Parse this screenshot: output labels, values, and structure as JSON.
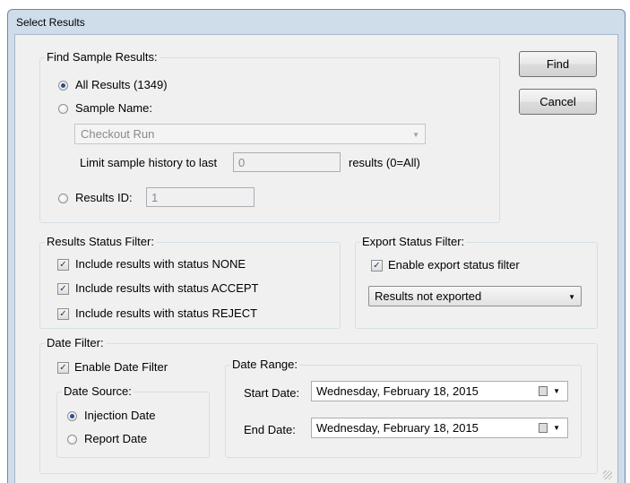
{
  "window": {
    "title": "Select Results"
  },
  "buttons": {
    "find": "Find",
    "cancel": "Cancel"
  },
  "find_sample": {
    "group_label": "Find Sample Results:",
    "all_results_label": "All Results (1349)",
    "sample_name_label": "Sample Name:",
    "sample_name_value": "Checkout Run",
    "limit_label": "Limit sample history to last",
    "limit_value": "0",
    "limit_suffix": "results (0=All)",
    "results_id_label": "Results ID:",
    "results_id_value": "1",
    "selected": "all_results"
  },
  "results_status": {
    "group_label": "Results Status Filter:",
    "items": [
      {
        "label": "Include results with status NONE",
        "checked": true
      },
      {
        "label": "Include results with status ACCEPT",
        "checked": true
      },
      {
        "label": "Include results with status REJECT",
        "checked": true
      }
    ]
  },
  "export_status": {
    "group_label": "Export Status Filter:",
    "enable_label": "Enable export status filter",
    "enable_checked": true,
    "selected_value": "Results not exported"
  },
  "date_filter": {
    "group_label": "Date Filter:",
    "enable_label": "Enable Date Filter",
    "enable_checked": true,
    "source": {
      "group_label": "Date Source:",
      "injection_label": "Injection Date",
      "report_label": "Report Date",
      "selected": "injection"
    },
    "range": {
      "group_label": "Date Range:",
      "start_label": "Start Date:",
      "start_value": "Wednesday,  February  18, 2015",
      "end_label": "End Date:",
      "end_value": "Wednesday,  February  18, 2015"
    }
  },
  "icons": {
    "check_glyph": "✓",
    "dropdown": "chevron-down-icon",
    "calendar": "calendar-icon"
  }
}
